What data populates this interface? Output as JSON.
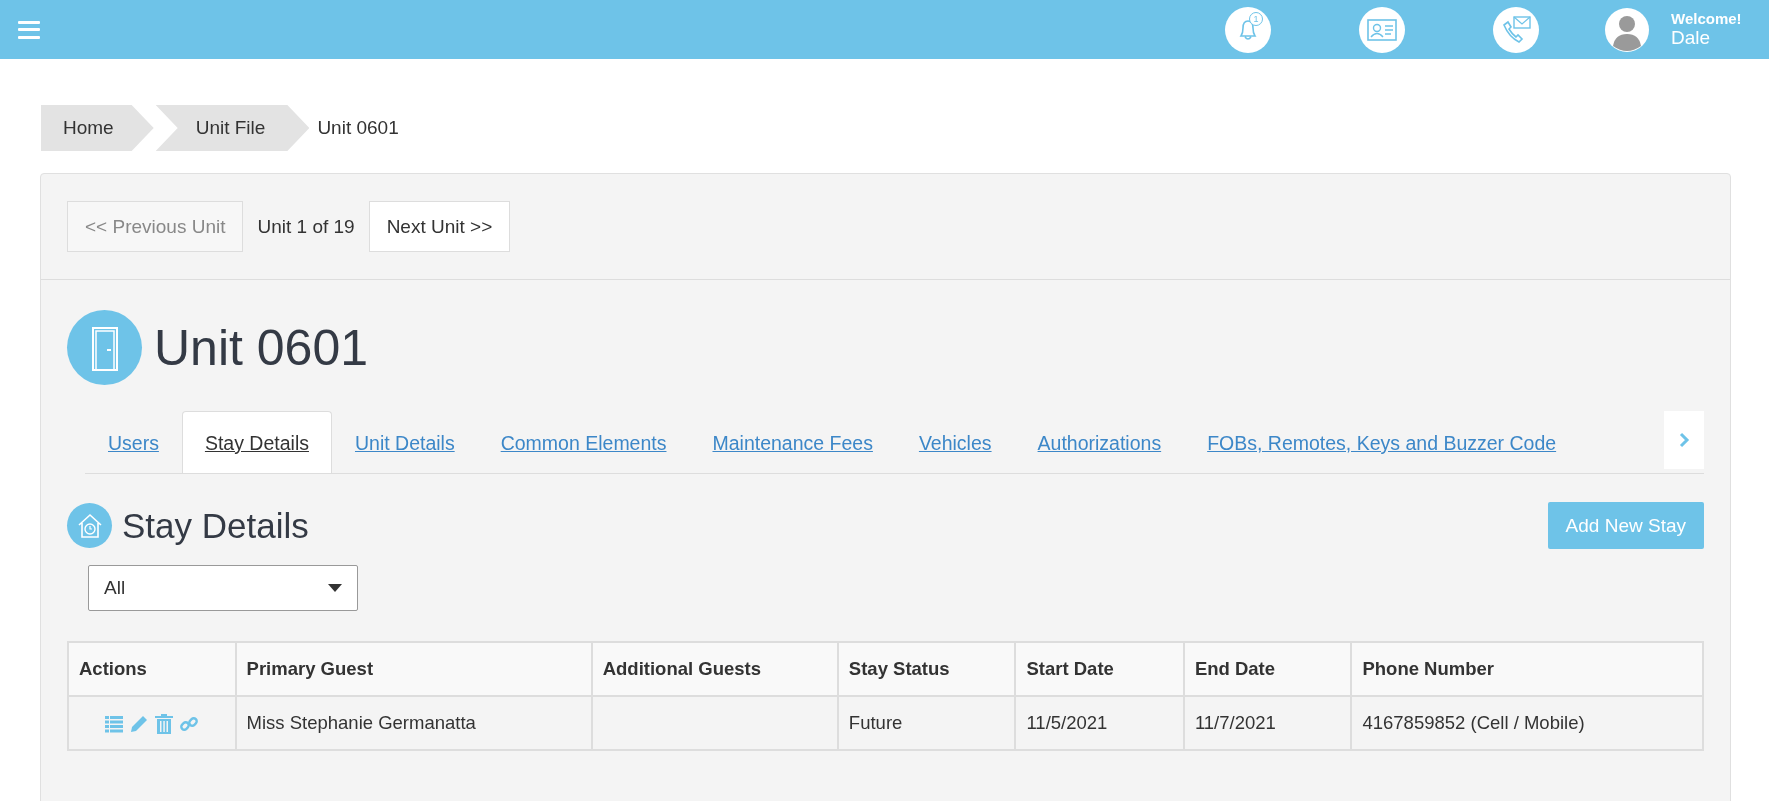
{
  "header": {
    "notification_count": "1",
    "welcome": "Welcome!",
    "user_name": "Dale"
  },
  "breadcrumb": [
    {
      "label": "Home",
      "kind": "link"
    },
    {
      "label": "Unit File",
      "kind": "link"
    },
    {
      "label": "Unit 0601",
      "kind": "current"
    }
  ],
  "pager": {
    "previous": {
      "label": "<< Previous Unit",
      "disabled": true
    },
    "position": "Unit 1 of 19",
    "next": {
      "label": "Next Unit >>",
      "disabled": false
    }
  },
  "unit_title": "Unit 0601",
  "tabs": [
    {
      "label": "Users",
      "selected": false
    },
    {
      "label": "Stay Details",
      "selected": true
    },
    {
      "label": "Unit Details",
      "selected": false
    },
    {
      "label": "Common Elements",
      "selected": false
    },
    {
      "label": "Maintenance Fees",
      "selected": false
    },
    {
      "label": "Vehicles",
      "selected": false
    },
    {
      "label": "Authorizations",
      "selected": false
    },
    {
      "label": "FOBs, Remotes, Keys and Buzzer Code",
      "selected": false
    }
  ],
  "section": {
    "title": "Stay Details",
    "add_button": "Add New Stay",
    "filter": {
      "value": "All"
    }
  },
  "table": {
    "columns": [
      "Actions",
      "Primary Guest",
      "Additional Guests",
      "Stay Status",
      "Start Date",
      "End Date",
      "Phone Number"
    ],
    "rows": [
      {
        "primary_guest": "Miss Stephanie Germanatta",
        "additional_guests": "",
        "stay_status": "Future",
        "start_date": "11/5/2021",
        "end_date": "11/7/2021",
        "phone_number": "4167859852 (Cell / Mobile)"
      }
    ]
  }
}
